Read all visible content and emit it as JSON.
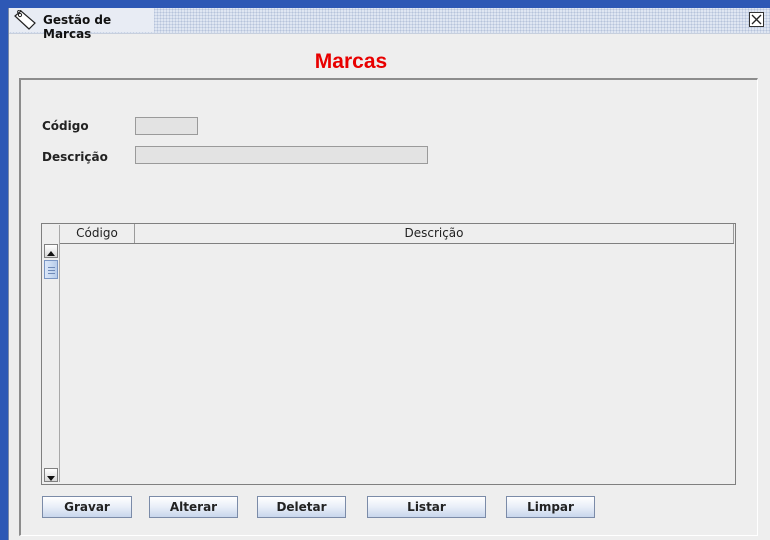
{
  "window": {
    "title": "Gestão de Marcas"
  },
  "heading": "Marcas",
  "form": {
    "codigo_label": "Código",
    "codigo_value": "",
    "descricao_label": "Descrição",
    "descricao_value": ""
  },
  "table": {
    "columns": [
      "Código",
      "Descrição"
    ],
    "rows": []
  },
  "buttons": {
    "gravar": "Gravar",
    "alterar": "Alterar",
    "deletar": "Deletar",
    "listar": "Listar",
    "limpar": "Limpar"
  },
  "icons": [
    "tag-icon",
    "close-icon",
    "scroll-up-icon",
    "scroll-down-icon"
  ],
  "colors": {
    "heading": "#e80000",
    "titlebar": "#dfe6f2",
    "background": "#2d58b5"
  }
}
